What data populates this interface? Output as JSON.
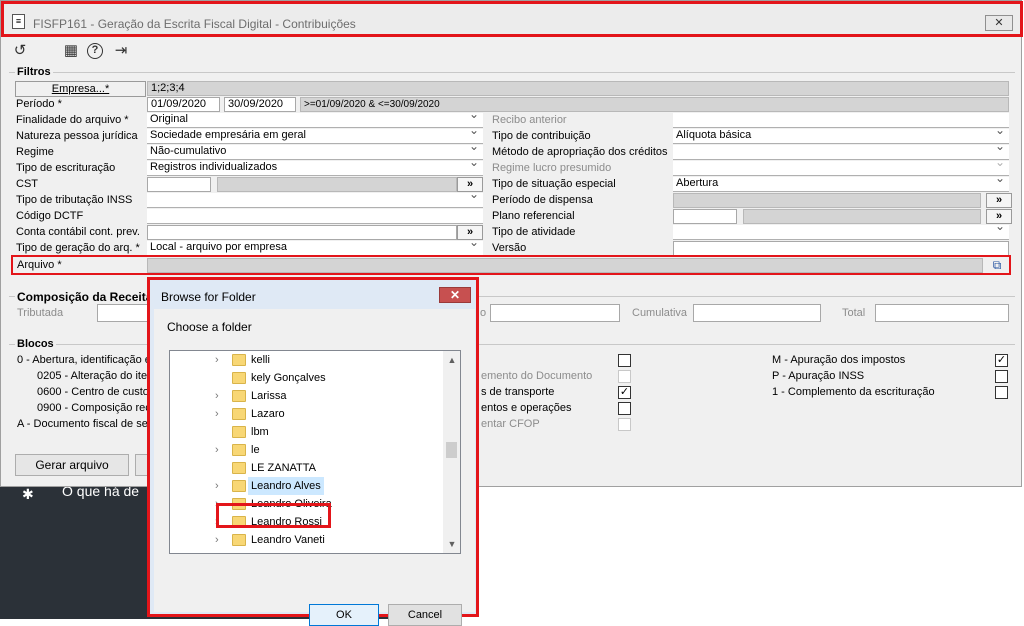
{
  "window": {
    "title": "FISFP161 - Geração da Escrita Fiscal Digital - Contribuições",
    "close_glyph": "✕"
  },
  "toolbar": {
    "items": [
      {
        "icon": "undo-icon",
        "glyph": "↺"
      },
      {
        "icon": "calendar-icon",
        "glyph": "▦"
      },
      {
        "icon": "help-icon",
        "glyph": "?"
      },
      {
        "icon": "exit-icon",
        "glyph": "⇥"
      }
    ]
  },
  "filtros": {
    "title": "Filtros",
    "empresa_button": "Empresa...*",
    "empresa_value": "1;2;3;4",
    "periodo_label": "Período *",
    "periodo_start": "01/09/2020",
    "periodo_end": "30/09/2020",
    "periodo_expr": ">=01/09/2020 & <=30/09/2020",
    "left": [
      {
        "label": "Finalidade do arquivo *",
        "value": "Original"
      },
      {
        "label": "Natureza pessoa jurídica",
        "value": "Sociedade empresária em geral"
      },
      {
        "label": "Regime",
        "value": "Não-cumulativo"
      },
      {
        "label": "Tipo de escrituração",
        "value": "Registros individualizados"
      },
      {
        "label": "CST",
        "value": ""
      },
      {
        "label": "Tipo de tributação INSS",
        "value": ""
      },
      {
        "label": "Código DCTF",
        "value": ""
      },
      {
        "label": "Conta contábil cont. prev.",
        "value": ""
      },
      {
        "label": "Tipo de geração do arq. *",
        "value": "Local - arquivo por empresa"
      }
    ],
    "right": [
      {
        "label": "Recibo anterior",
        "value": ""
      },
      {
        "label": "Tipo de contribuição",
        "value": "Alíquota básica"
      },
      {
        "label": "Método de apropriação dos créditos",
        "value": ""
      },
      {
        "label": "Regime lucro presumido",
        "value": ""
      },
      {
        "label": "Tipo de situação especial",
        "value": "Abertura"
      },
      {
        "label": "Período de dispensa",
        "value": ""
      },
      {
        "label": "Plano referencial",
        "value": ""
      },
      {
        "label": "Tipo de atividade",
        "value": ""
      },
      {
        "label": "Versão",
        "value": ""
      }
    ],
    "arquivo_label": "Arquivo *",
    "more_glyph": "»"
  },
  "composicao": {
    "title": "Composição da Receita",
    "tributada_label": "Tributada",
    "cumulativa_label": "Cumulativa",
    "total_label": "Total"
  },
  "blocos": {
    "title": "Blocos",
    "left_items": [
      "0 - Abertura, identificação e",
      "0205 - Alteração do ite",
      "0600 - Centro de custo",
      "0900 - Composição rec",
      "A - Documento fiscal de se"
    ],
    "mid_items": [
      {
        "label": "emento do Documento",
        "checked": false
      },
      {
        "label": "s de transporte",
        "checked": true
      },
      {
        "label": "entos e operações",
        "checked": false
      },
      {
        "label": "entar CFOP",
        "checked": false
      }
    ],
    "right_items": [
      {
        "label": "M - Apuração dos impostos",
        "checked": true
      },
      {
        "label": "P - Apuração INSS",
        "checked": false
      },
      {
        "label": "1 - Complemento da escrituração",
        "checked": false
      }
    ],
    "check_glyph": "✓"
  },
  "actions": {
    "gerar_arquivo": "Gerar arquivo"
  },
  "background": {
    "text": "O que há de",
    "icon_glyph": "✱"
  },
  "dialog": {
    "title": "Browse for Folder",
    "close_glyph": "✕",
    "prompt": "Choose a folder",
    "chevron": "›",
    "folders": [
      {
        "name": "kelli",
        "has_children": true
      },
      {
        "name": "kely Gonçalves",
        "has_children": false
      },
      {
        "name": "Larissa",
        "has_children": true
      },
      {
        "name": "Lazaro",
        "has_children": true
      },
      {
        "name": "lbm",
        "has_children": false
      },
      {
        "name": "le",
        "has_children": true
      },
      {
        "name": "LE ZANATTA",
        "has_children": false
      },
      {
        "name": "Leandro Alves",
        "has_children": true,
        "selected": true
      },
      {
        "name": "Leandro Oliveira",
        "has_children": true
      },
      {
        "name": "Leandro Rossi",
        "has_children": true
      },
      {
        "name": "Leandro Vaneti",
        "has_children": true
      }
    ],
    "ok": "OK",
    "cancel": "Cancel"
  }
}
